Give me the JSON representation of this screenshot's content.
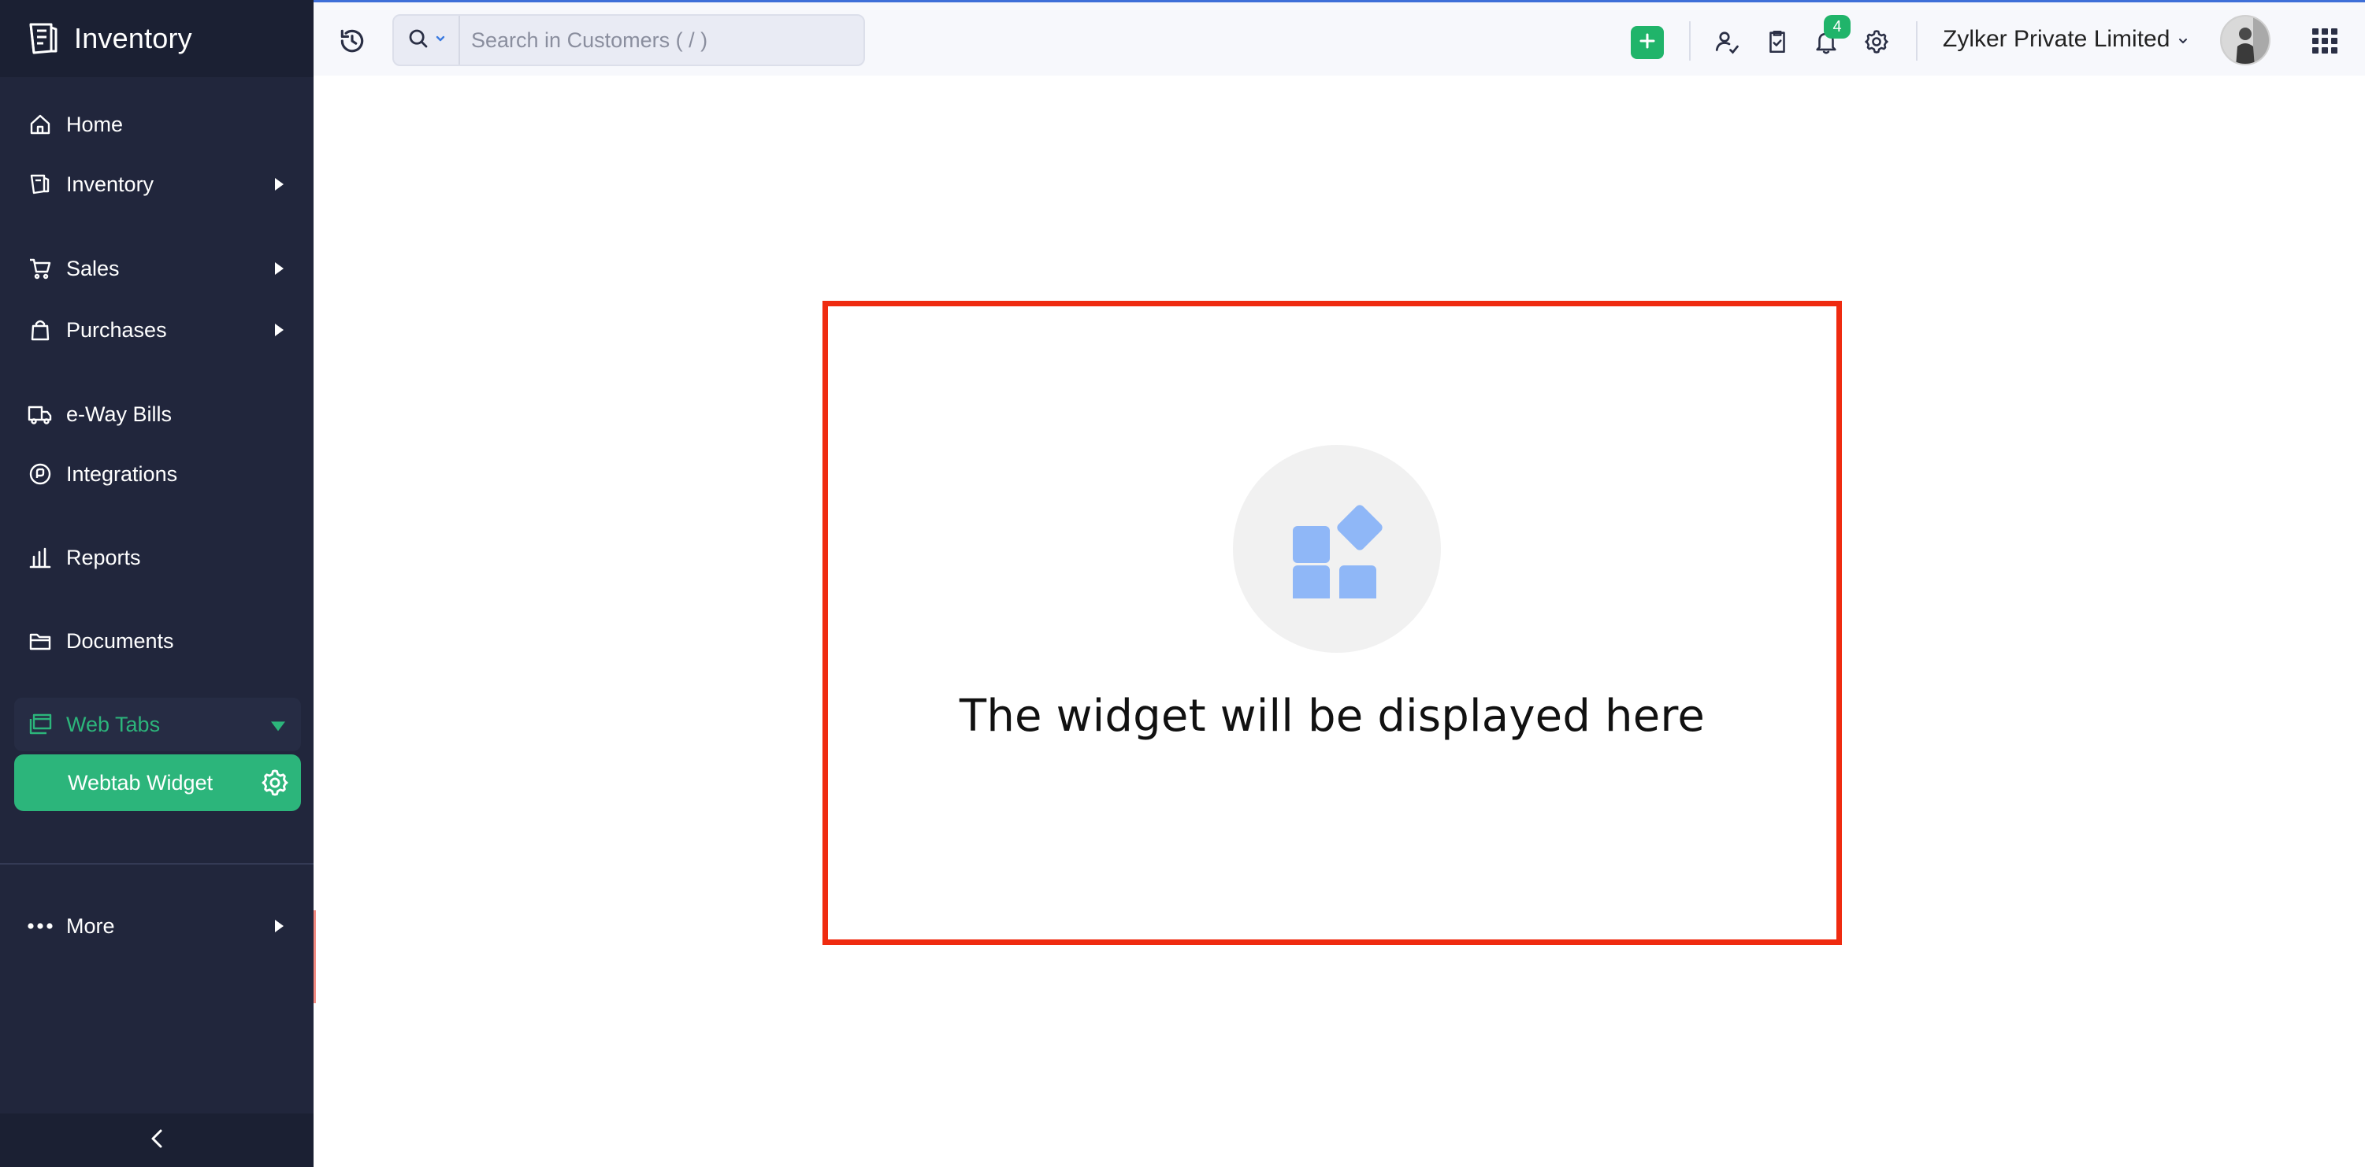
{
  "app": {
    "brand": "Inventory"
  },
  "sidebar": {
    "items": [
      {
        "label": "Home",
        "icon": "home-icon",
        "has_arrow": false
      },
      {
        "label": "Inventory",
        "icon": "inventory-icon",
        "has_arrow": true
      },
      {
        "label": "Sales",
        "icon": "cart-icon",
        "has_arrow": true
      },
      {
        "label": "Purchases",
        "icon": "bag-icon",
        "has_arrow": true
      },
      {
        "label": "e-Way Bills",
        "icon": "truck-icon",
        "has_arrow": false
      },
      {
        "label": "Integrations",
        "icon": "integrations-icon",
        "has_arrow": false
      },
      {
        "label": "Reports",
        "icon": "reports-icon",
        "has_arrow": false
      },
      {
        "label": "Documents",
        "icon": "folder-icon",
        "has_arrow": false
      },
      {
        "label": "Web Tabs",
        "icon": "web-tabs-icon",
        "expanded": true
      },
      {
        "label": "More",
        "icon": "more-dots-icon",
        "has_arrow": true
      }
    ],
    "sub_item": {
      "label": "Webtab Widget",
      "selected": true
    }
  },
  "topbar": {
    "search_placeholder": "Search in Customers ( / )",
    "notification_count": "4",
    "organization": "Zylker Private Limited"
  },
  "main": {
    "widget_message": "The widget will be displayed here"
  },
  "colors": {
    "sidebar_bg": "#21263c",
    "accent_green": "#2cb57b",
    "frame_red": "#ef2b10",
    "widget_icon_blue": "#8fb7f7"
  }
}
